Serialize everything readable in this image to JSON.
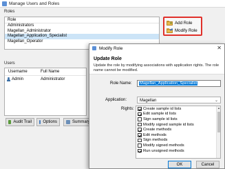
{
  "main_window": {
    "title": "Manage Users and Roles",
    "roles_label": "Roles",
    "roles_column": "Role",
    "roles": [
      {
        "name": "Administrators",
        "selected": false
      },
      {
        "name": "Magellan_Administrator",
        "selected": false
      },
      {
        "name": "Magellan_Application_Specialist",
        "selected": true
      },
      {
        "name": "Magellan_Operator",
        "selected": false
      }
    ],
    "add_role_label": "Add Role",
    "modify_role_label": "Modify Role",
    "users_label": "Users",
    "users_columns": {
      "username": "Username",
      "full_name": "Full Name"
    },
    "users": [
      {
        "username": "Admin",
        "full_name": "Administrator"
      }
    ],
    "bottom_buttons": {
      "audit_trail": "Audit Trail",
      "options": "Options",
      "summary": "Summary"
    }
  },
  "dialog": {
    "title": "Modify Role",
    "heading": "Update Role",
    "description": "Update the role by modifying associations with application rights. The role name cannot be modified.",
    "role_name_label": "Role Name:",
    "role_name_value": "Magellan_Application_Specialist",
    "application_label": "Application:",
    "application_value": "Magellan",
    "rights_label": "Rights:",
    "rights": [
      {
        "label": "Create sample id lists",
        "checked": true
      },
      {
        "label": "Edit sample id lists",
        "checked": true
      },
      {
        "label": "Sign sample id lists",
        "checked": false
      },
      {
        "label": "Modify signed sample id lists",
        "checked": false
      },
      {
        "label": "Create methods",
        "checked": true
      },
      {
        "label": "Edit methods",
        "checked": true
      },
      {
        "label": "Sign methods",
        "checked": false
      },
      {
        "label": "Modify signed methods",
        "checked": false
      },
      {
        "label": "Run unsigned methods",
        "checked": true
      }
    ],
    "ok_label": "OK",
    "cancel_label": "Cancel"
  },
  "colors": {
    "highlight_box": "#e0302a",
    "selection": "#cce4f7",
    "text_selection": "#0078d7"
  }
}
